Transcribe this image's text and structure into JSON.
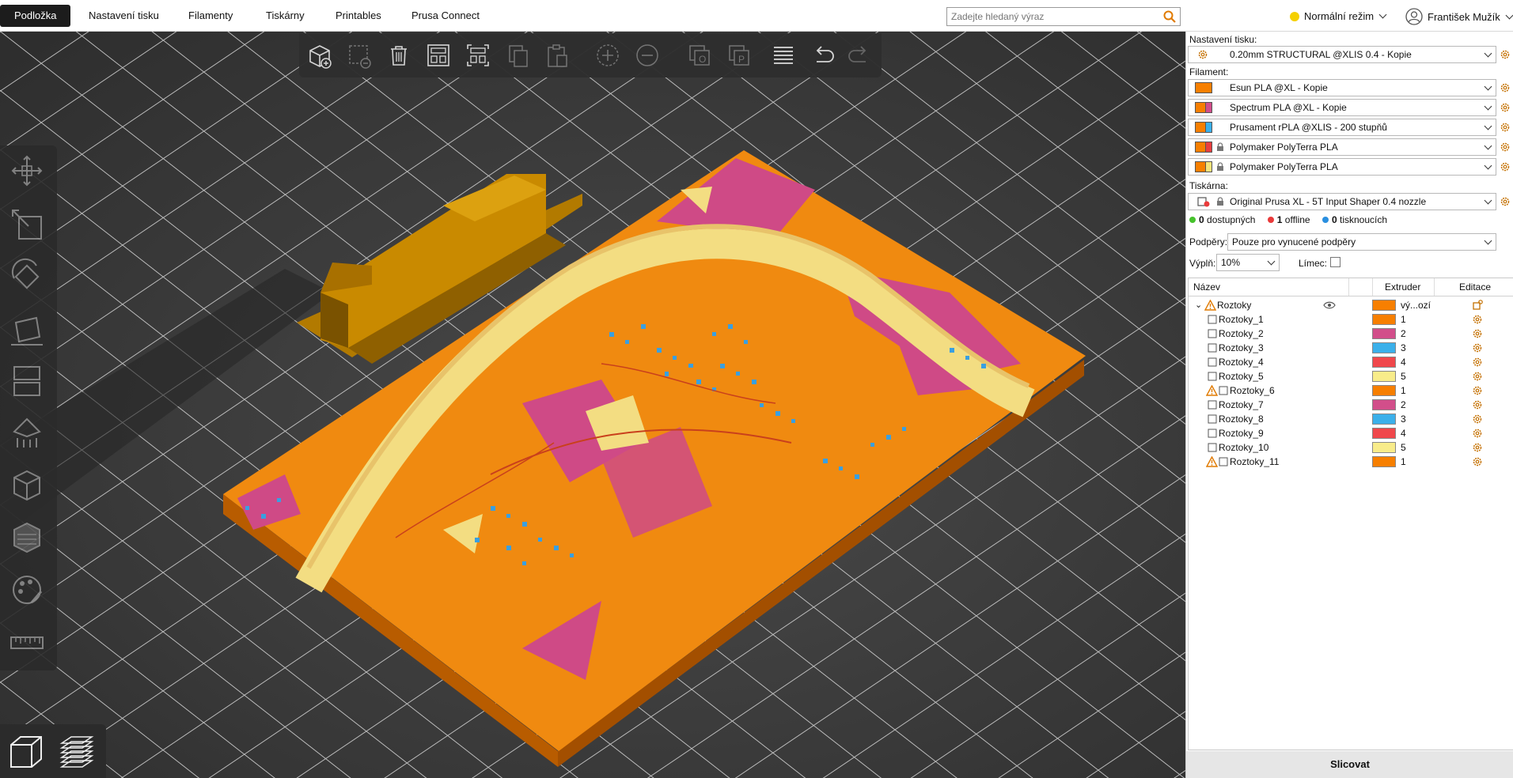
{
  "tabs": [
    {
      "label": "Podložka",
      "active": true
    },
    {
      "label": "Nastavení tisku",
      "active": false
    },
    {
      "label": "Filamenty",
      "active": false
    },
    {
      "label": "Tiskárny",
      "active": false
    },
    {
      "label": "Printables",
      "active": false
    },
    {
      "label": "Prusa Connect",
      "active": false
    }
  ],
  "search": {
    "placeholder": "Zadejte hledaný výraz",
    "icon": "search-icon"
  },
  "mode": {
    "label": "Normální režim",
    "color": "#f5d000"
  },
  "user": {
    "name": "František Mužík"
  },
  "panel": {
    "print_settings_label": "Nastavení tisku:",
    "print_profile": "0.20mm STRUCTURAL @XLIS 0.4 - Kopie",
    "filament_label": "Filament:",
    "filaments": [
      {
        "name": "Esun PLA @XL - Kopie",
        "colors": [
          "#f77f00"
        ],
        "locked": false
      },
      {
        "name": "Spectrum PLA @XL - Kopie",
        "colors": [
          "#f77f00",
          "#d24e8a"
        ],
        "locked": false
      },
      {
        "name": "Prusament rPLA @XLIS - 200 stupňů",
        "colors": [
          "#f77f00",
          "#3bb0ea"
        ],
        "locked": false
      },
      {
        "name": "Polymaker PolyTerra PLA",
        "colors": [
          "#f77f00",
          "#e93f3f"
        ],
        "locked": true
      },
      {
        "name": "Polymaker PolyTerra PLA",
        "colors": [
          "#f77f00",
          "#f5e37a"
        ],
        "locked": true
      }
    ],
    "printer_label": "Tiskárna:",
    "printer": "Original Prusa XL - 5T Input Shaper 0.4 nozzle",
    "status": [
      {
        "count": "0",
        "label": "dostupných",
        "color": "#46c22c"
      },
      {
        "count": "1",
        "label": "offline",
        "color": "#e93a3a"
      },
      {
        "count": "0",
        "label": "tisknoucích",
        "color": "#2a8fe0"
      }
    ],
    "supports_label": "Podpěry:",
    "supports_value": "Pouze pro vynucené podpěry",
    "infill_label": "Výplň:",
    "infill_value": "10%",
    "brim_label": "Límec:",
    "brim_checked": false,
    "columns": {
      "name": "Název",
      "extruder": "Extruder",
      "edit": "Editace"
    },
    "objects": [
      {
        "name": "Roztoky",
        "level": 0,
        "warning": true,
        "extruder": "vý...ozí",
        "color": "#f77f00",
        "visible": true
      },
      {
        "name": "Roztoky_1",
        "level": 1,
        "warning": false,
        "extruder": "1",
        "color": "#f77f00"
      },
      {
        "name": "Roztoky_2",
        "level": 1,
        "warning": false,
        "extruder": "2",
        "color": "#d24e8a"
      },
      {
        "name": "Roztoky_3",
        "level": 1,
        "warning": false,
        "extruder": "3",
        "color": "#3bb0ea"
      },
      {
        "name": "Roztoky_4",
        "level": 1,
        "warning": false,
        "extruder": "4",
        "color": "#f0474b"
      },
      {
        "name": "Roztoky_5",
        "level": 1,
        "warning": false,
        "extruder": "5",
        "color": "#f8ec8a"
      },
      {
        "name": "Roztoky_6",
        "level": 1,
        "warning": true,
        "extruder": "1",
        "color": "#f77f00"
      },
      {
        "name": "Roztoky_7",
        "level": 1,
        "warning": false,
        "extruder": "2",
        "color": "#d24e8a"
      },
      {
        "name": "Roztoky_8",
        "level": 1,
        "warning": false,
        "extruder": "3",
        "color": "#3bb0ea"
      },
      {
        "name": "Roztoky_9",
        "level": 1,
        "warning": false,
        "extruder": "4",
        "color": "#f0474b"
      },
      {
        "name": "Roztoky_10",
        "level": 1,
        "warning": false,
        "extruder": "5",
        "color": "#f8ec8a"
      },
      {
        "name": "Roztoky_11",
        "level": 1,
        "warning": true,
        "extruder": "1",
        "color": "#f77f00"
      }
    ],
    "slice_label": "Slicovat"
  },
  "toolbar_icons": [
    "add-object-icon",
    "delete-object-icon",
    "delete-all-icon",
    "arrange-icon",
    "arrange-selection-icon",
    "copy-icon",
    "paste-icon",
    "add-instance-icon",
    "remove-instance-icon",
    "split-objects-icon",
    "split-parts-icon",
    "layers-editing-icon",
    "undo-icon",
    "redo-icon"
  ],
  "left_tools": [
    "move-icon",
    "scale-icon",
    "rotate-icon",
    "place-on-face-icon",
    "cut-icon",
    "supports-paint-icon",
    "seam-paint-icon",
    "mmu-paint-icon",
    "measure-icon"
  ],
  "view_tools": [
    "3d-view-icon",
    "preview-layers-icon"
  ]
}
